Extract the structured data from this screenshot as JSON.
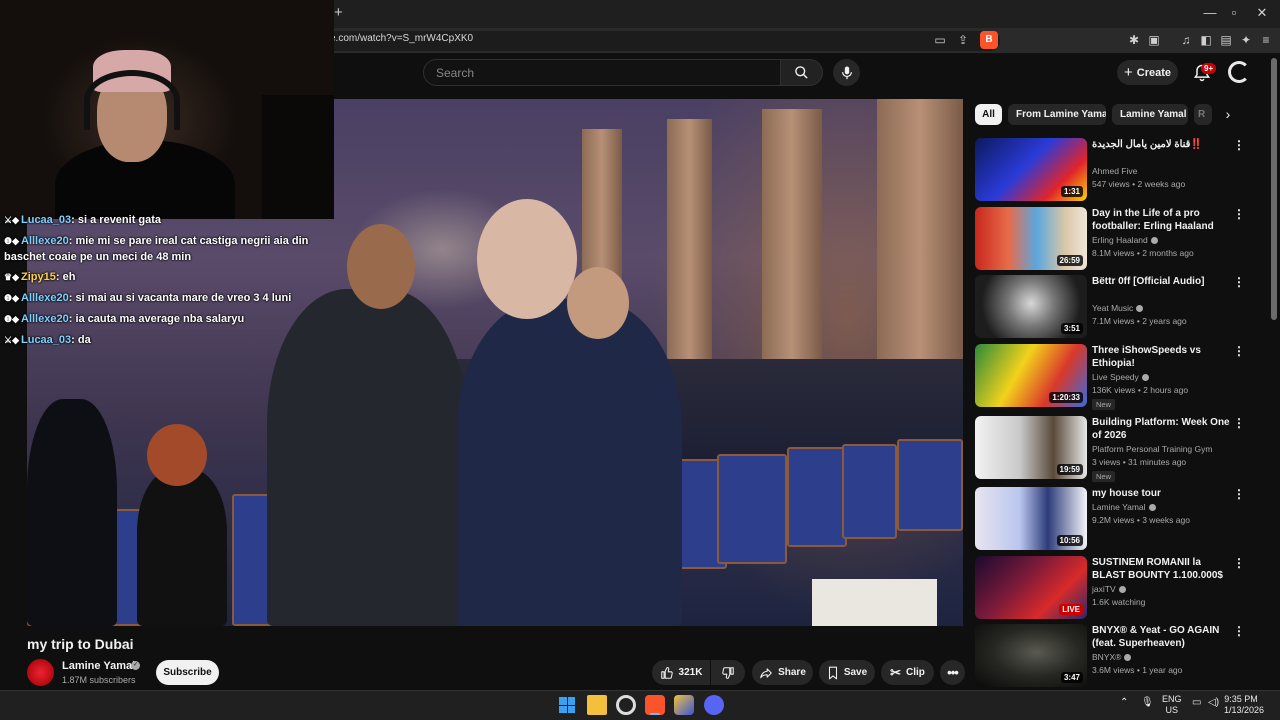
{
  "browser": {
    "new_tab_glyph": "+",
    "url": "e.com/watch?v=S_mrW4CpXK0",
    "window_controls": [
      "—",
      "▫",
      "✕"
    ]
  },
  "header": {
    "search_placeholder": "Search",
    "create_label": "Create",
    "notifications_badge": "9+"
  },
  "stream_chat": [
    {
      "user": "Lucaa_03",
      "text": "si a revenit gata",
      "user_color": "#7fd0ff"
    },
    {
      "user": "Alllexe20",
      "text": "mie mi se pare ireal cat castiga negrii aia din baschet coaie pe un meci de 48 min",
      "user_color": "#7fd0ff"
    },
    {
      "user": "Zipy15",
      "text": "eh",
      "user_color": "#ffd24a"
    },
    {
      "user": "Alllexe20",
      "text": "si mai au si vacanta mare de vreo 3 4 luni",
      "user_color": "#7fd0ff"
    },
    {
      "user": "Alllexe20",
      "text": "ia cauta ma average nba salaryu",
      "user_color": "#7fd0ff"
    },
    {
      "user": "Lucaa_03",
      "text": "da",
      "user_color": "#7fd0ff"
    }
  ],
  "video": {
    "title": "my trip to Dubai",
    "channel": "Lamine Yamal",
    "subscribers": "1.87M subscribers",
    "subscribe_label": "Subscribe",
    "likes": "321K",
    "share_label": "Share",
    "save_label": "Save",
    "clip_label": "Clip",
    "verified_glyph": "✓"
  },
  "chips": [
    "All",
    "From Lamine Yamal",
    "Lamine Yamal",
    "R"
  ],
  "recommendations": [
    {
      "title": "قناة لامين يامال الجديدة‼️",
      "channel": "Ahmed Five",
      "verified": false,
      "meta": "547 views • 2 weeks ago",
      "duration": "1:31",
      "badge": "",
      "thumb": "linear-gradient(135deg,#0b1a5e 0%,#2b3bd8 45%,#e0242d 75%,#ffd400 100%)"
    },
    {
      "title": "Day in the Life of a pro footballer: Erling Haaland",
      "channel": "Erling Haaland",
      "verified": true,
      "meta": "8.1M views • 2 months ago",
      "duration": "26:59",
      "badge": "",
      "thumb": "linear-gradient(90deg,#c8281e 0%,#e86b4a 30%,#5aa7de 55%,#d9c6a8 80%,#f0e6d8 100%)"
    },
    {
      "title": "Bëttr 0ff [Official Audio]",
      "channel": "Yeat Music",
      "verified": true,
      "meta": "7.1M views • 2 years ago",
      "duration": "3:51",
      "badge": "",
      "thumb": "radial-gradient(circle at 50% 45%,#d8d8d8 0%,#777 35%,#1d1d1d 75%)"
    },
    {
      "title": "Three iShowSpeeds vs Ethiopia!",
      "channel": "Live Speedy",
      "verified": true,
      "meta": "136K views • 2 hours ago",
      "duration": "1:20:33",
      "badge": "New",
      "thumb": "linear-gradient(120deg,#2a8a3a 0%,#f2d21b 40%,#d9382b 70%,#3a6ad9 100%)"
    },
    {
      "title": "Building Platform: Week One of 2026",
      "channel": "Platform Personal Training Gym",
      "verified": false,
      "meta": "3 views • 31 minutes ago",
      "duration": "19:59",
      "badge": "New",
      "thumb": "linear-gradient(90deg,#f2f2f2 0%,#c9c9c9 40%,#5a4a3a 70%,#e8e8e8 100%)"
    },
    {
      "title": "my house tour",
      "channel": "Lamine Yamal",
      "verified": true,
      "meta": "9.2M views • 3 weeks ago",
      "duration": "10:56",
      "badge": "",
      "thumb": "linear-gradient(90deg,#e8e4f0 0%,#b9c6ee 40%,#2d3c7a 65%,#f4f4f8 100%)"
    },
    {
      "title": "SUSTINEM ROMANII la BLAST BOUNTY 1.100.000$",
      "channel": "jaxiTV",
      "verified": true,
      "meta": "1.6K watching",
      "duration": "LIVE",
      "badge": "",
      "thumb": "linear-gradient(135deg,#1a0a2e 0%,#7a1a3a 40%,#d82a2a 70%,#2a2a6a 100%)"
    },
    {
      "title": "BNYX® & Yeat - GO AGAIN (feat. Superheaven)",
      "channel": "BNYX®",
      "verified": true,
      "meta": "3.6M views • 1 year ago",
      "duration": "3:47",
      "badge": "",
      "thumb": "radial-gradient(ellipse at 55% 45%,#5a5a52 0%,#262622 50%,#0a0a0a 100%)"
    }
  ],
  "taskbar": {
    "language": "ENG",
    "region": "US",
    "time": "9:35 PM",
    "date": "1/13/2026"
  }
}
